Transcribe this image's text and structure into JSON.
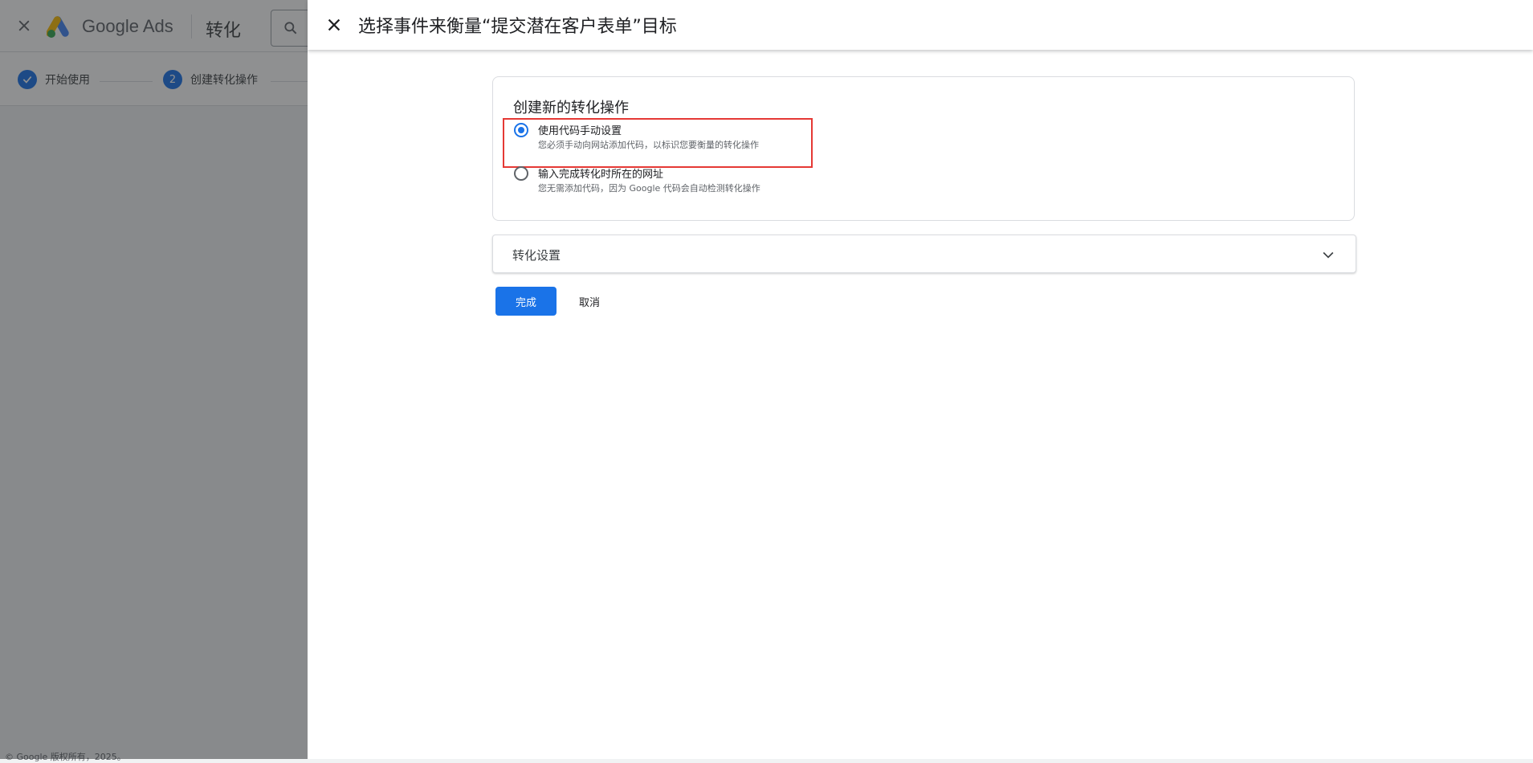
{
  "background": {
    "brand": "Google Ads",
    "page_title": "转化",
    "steps": [
      {
        "label": "开始使用",
        "state": "done"
      },
      {
        "number": "2",
        "label": "创建转化操作",
        "state": "current"
      }
    ],
    "footer": "© Google 版权所有，2025。"
  },
  "dialog": {
    "title": "选择事件来衡量“提交潜在客户表单”目标",
    "section_title": "创建新的转化操作",
    "options": [
      {
        "label": "使用代码手动设置",
        "description": "您必须手动向网站添加代码，以标识您要衡量的转化操作",
        "selected": true
      },
      {
        "label": "输入完成转化时所在的网址",
        "description": "您无需添加代码，因为 Google 代码会自动检测转化操作",
        "selected": false
      }
    ],
    "accordion_label": "转化设置",
    "done_label": "完成",
    "cancel_label": "取消"
  },
  "colors": {
    "primary": "#1a73e8",
    "highlight": "#e53935"
  },
  "icons": {
    "dialog_close": "close-icon",
    "accordion": "chevron-down-icon",
    "step_done": "check-icon",
    "search": "search-icon"
  }
}
